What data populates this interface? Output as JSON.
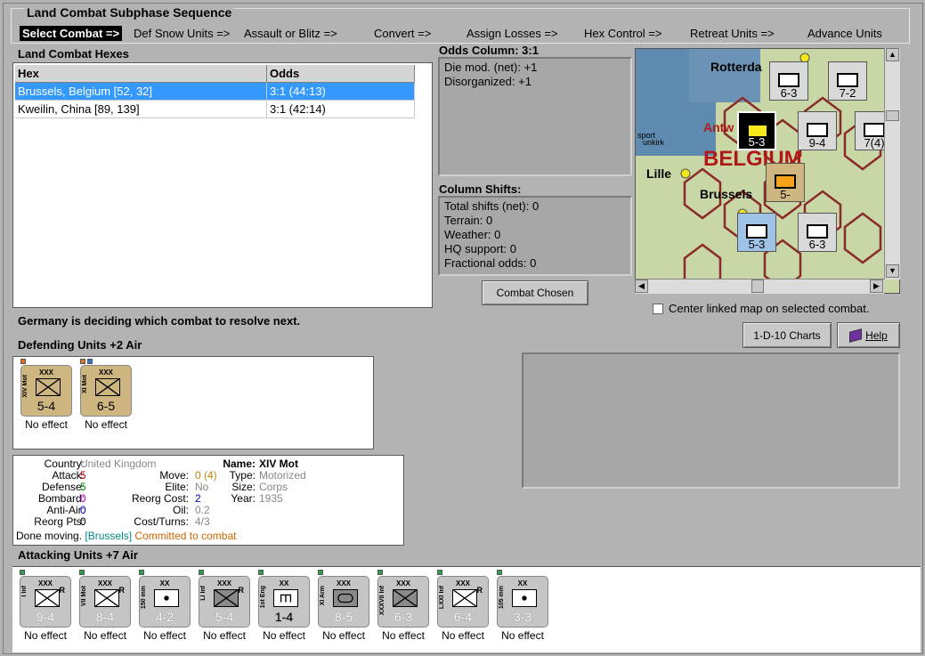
{
  "phase": {
    "title": "Land Combat Subphase Sequence",
    "steps": [
      "Select Combat =>",
      "Def Snow Units =>",
      "Assault or Blitz =>",
      "Convert =>",
      "Assign Losses =>",
      "Hex Control =>",
      "Retreat Units =>",
      "Advance Units"
    ]
  },
  "hexes": {
    "title": "Land Combat Hexes",
    "headers": [
      "Hex",
      "Odds"
    ],
    "rows": [
      {
        "hex": "Brussels, Belgium [52, 32]",
        "odds": "3:1 (44:13)"
      },
      {
        "hex": "Kweilin, China [89, 139]",
        "odds": "3:1 (42:14)"
      }
    ]
  },
  "odds": {
    "title": "Odds Column: 3:1",
    "lines": [
      "Die mod. (net): +1",
      "Disorganized: +1"
    ]
  },
  "shifts": {
    "title": "Column Shifts:",
    "lines": [
      "Total shifts (net): 0",
      "Terrain: 0",
      "Weather: 0",
      "HQ support: 0",
      "Fractional odds: 0"
    ]
  },
  "buttons": {
    "combat_chosen": "Combat Chosen",
    "charts": "1-D-10 Charts",
    "help": "Help"
  },
  "map": {
    "labels": {
      "rotterdam": "Rotterda",
      "antwerp": "Antw",
      "belgium": "BELGIUM",
      "lille": "Lille",
      "brussels": "Brussels",
      "dunkirk": "unkirk",
      "sport": "sport"
    },
    "counters": [
      "6-3",
      "7-2",
      "5-3",
      "9-4",
      "5-",
      "5-3",
      "6-3",
      "7(4)"
    ]
  },
  "center_linked_label": "Center linked map on selected combat.",
  "status_message": "Germany is deciding which combat to resolve next.",
  "defending": {
    "title": "Defending Units +2 Air",
    "units": [
      {
        "size": "XXX",
        "name": "XIV Mot",
        "str": "5-4",
        "effect": "No effect"
      },
      {
        "size": "XXX",
        "name": "XI Mot",
        "str": "6-5",
        "effect": "No effect"
      }
    ]
  },
  "detail": {
    "country_label": "Country:",
    "country": "United Kingdom",
    "attack_label": "Attack:",
    "attack": "5",
    "defense_label": "Defense:",
    "defense": "5",
    "bombard_label": "Bombard:",
    "bombard": "0",
    "antiair_label": "Anti-Air:",
    "antiair": "0",
    "reorgpts_label": "Reorg Pts:",
    "reorgpts": "0",
    "move_label": "Move:",
    "move": "0 (4)",
    "elite_label": "Elite:",
    "elite": "No",
    "reorgcost_label": "Reorg Cost:",
    "reorgcost": "2",
    "oil_label": "Oil:",
    "oil": "0.2",
    "costturns_label": "Cost/Turns:",
    "costturns": "4/3",
    "name_label": "Name:",
    "name": "XIV Mot",
    "type_label": "Type:",
    "type": "Motorized",
    "size_label": "Size:",
    "size": "Corps",
    "year_label": "Year:",
    "year": "1935",
    "done": "Done moving.",
    "location": "[Brussels]",
    "committed": "Committed to combat"
  },
  "attacking": {
    "title": "Attacking Units +7 Air",
    "units": [
      {
        "size": "XXX",
        "name": "I Inf",
        "str": "9-4",
        "effect": "No effect"
      },
      {
        "size": "XXX",
        "name": "VII Mot",
        "str": "8-4",
        "effect": "No effect"
      },
      {
        "size": "XX",
        "name": "150 mm",
        "str": "4-2",
        "effect": "No effect"
      },
      {
        "size": "XXX",
        "name": "LI Inf",
        "str": "5-4",
        "effect": "No effect"
      },
      {
        "size": "XX",
        "name": "1st Eng",
        "str": "1-4",
        "effect": "No effect"
      },
      {
        "size": "XXX",
        "name": "XI Arm",
        "str": "8-5",
        "effect": "No effect"
      },
      {
        "size": "XXX",
        "name": "XXXVII Inf",
        "str": "6-3",
        "effect": "No effect"
      },
      {
        "size": "XXX",
        "name": "LXXI Inf",
        "str": "6-4",
        "effect": "No effect"
      },
      {
        "size": "XX",
        "name": "105 mm",
        "str": "3-3",
        "effect": "No effect"
      }
    ]
  },
  "colors": {
    "selected_row": "#3399ff",
    "attack": "#cc0000",
    "defense": "#008800",
    "bombard": "#cc00cc",
    "antiair": "#0000cc",
    "location": "#008888",
    "committed": "#cc6600",
    "map_belgium": "#b01818"
  }
}
